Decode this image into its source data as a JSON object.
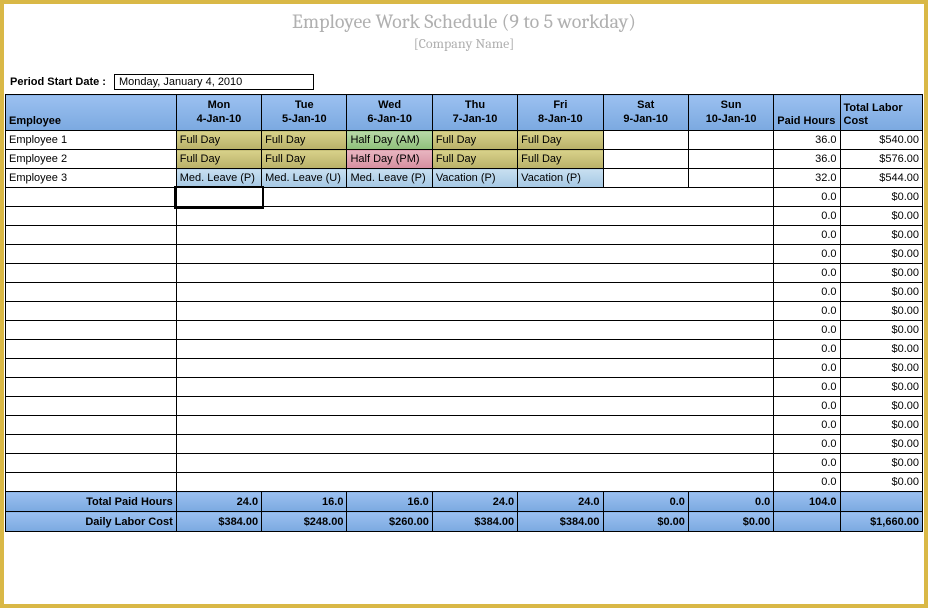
{
  "title": "Employee Work Schedule (9 to 5  workday)",
  "company": "[Company Name]",
  "period_label": "Period Start Date :",
  "period_value": "Monday, January 4, 2010",
  "cols": {
    "employee": "Employee",
    "days": [
      {
        "top": "Mon",
        "bot": "4-Jan-10"
      },
      {
        "top": "Tue",
        "bot": "5-Jan-10"
      },
      {
        "top": "Wed",
        "bot": "6-Jan-10"
      },
      {
        "top": "Thu",
        "bot": "7-Jan-10"
      },
      {
        "top": "Fri",
        "bot": "8-Jan-10"
      },
      {
        "top": "Sat",
        "bot": "9-Jan-10"
      },
      {
        "top": "Sun",
        "bot": "10-Jan-10"
      }
    ],
    "paid_hours": "Paid Hours",
    "labor_cost": "Total Labor Cost"
  },
  "rows": [
    {
      "name": "Employee 1",
      "cells": [
        {
          "t": "Full Day",
          "c": "full"
        },
        {
          "t": "Full Day",
          "c": "full"
        },
        {
          "t": "Half Day (AM)",
          "c": "half-am"
        },
        {
          "t": "Full Day",
          "c": "full"
        },
        {
          "t": "Full Day",
          "c": "full"
        },
        {
          "t": "",
          "c": ""
        },
        {
          "t": "",
          "c": ""
        }
      ],
      "ph": "36.0",
      "lc": "$540.00"
    },
    {
      "name": "Employee 2",
      "cells": [
        {
          "t": "Full Day",
          "c": "full"
        },
        {
          "t": "Full Day",
          "c": "full"
        },
        {
          "t": "Half Day (PM)",
          "c": "half-pm"
        },
        {
          "t": "Full Day",
          "c": "full"
        },
        {
          "t": "Full Day",
          "c": "full"
        },
        {
          "t": "",
          "c": ""
        },
        {
          "t": "",
          "c": ""
        }
      ],
      "ph": "36.0",
      "lc": "$576.00"
    },
    {
      "name": "Employee 3",
      "cells": [
        {
          "t": "Med. Leave (P)",
          "c": "med"
        },
        {
          "t": "Med. Leave (U)",
          "c": "med"
        },
        {
          "t": "Med. Leave (P)",
          "c": "med"
        },
        {
          "t": "Vacation (P)",
          "c": "vac"
        },
        {
          "t": "Vacation (P)",
          "c": "vac"
        },
        {
          "t": "",
          "c": ""
        },
        {
          "t": "",
          "c": ""
        }
      ],
      "ph": "32.0",
      "lc": "$544.00"
    },
    {
      "name": "",
      "cells": [
        {
          "t": "",
          "c": "",
          "sel": true
        },
        {
          "t": "",
          "c": ""
        },
        {
          "t": "",
          "c": ""
        },
        {
          "t": "",
          "c": ""
        },
        {
          "t": "",
          "c": ""
        },
        {
          "t": "",
          "c": ""
        },
        {
          "t": "",
          "c": ""
        }
      ],
      "ph": "0.0",
      "lc": "$0.00"
    },
    {
      "name": "",
      "cells": [
        {
          "t": "",
          "c": ""
        },
        {
          "t": "",
          "c": ""
        },
        {
          "t": "",
          "c": ""
        },
        {
          "t": "",
          "c": ""
        },
        {
          "t": "",
          "c": ""
        },
        {
          "t": "",
          "c": ""
        },
        {
          "t": "",
          "c": ""
        }
      ],
      "ph": "0.0",
      "lc": "$0.00"
    },
    {
      "name": "",
      "cells": [
        {
          "t": "",
          "c": ""
        },
        {
          "t": "",
          "c": ""
        },
        {
          "t": "",
          "c": ""
        },
        {
          "t": "",
          "c": ""
        },
        {
          "t": "",
          "c": ""
        },
        {
          "t": "",
          "c": ""
        },
        {
          "t": "",
          "c": ""
        }
      ],
      "ph": "0.0",
      "lc": "$0.00"
    },
    {
      "name": "",
      "cells": [
        {
          "t": "",
          "c": ""
        },
        {
          "t": "",
          "c": ""
        },
        {
          "t": "",
          "c": ""
        },
        {
          "t": "",
          "c": ""
        },
        {
          "t": "",
          "c": ""
        },
        {
          "t": "",
          "c": ""
        },
        {
          "t": "",
          "c": ""
        }
      ],
      "ph": "0.0",
      "lc": "$0.00"
    },
    {
      "name": "",
      "cells": [
        {
          "t": "",
          "c": ""
        },
        {
          "t": "",
          "c": ""
        },
        {
          "t": "",
          "c": ""
        },
        {
          "t": "",
          "c": ""
        },
        {
          "t": "",
          "c": ""
        },
        {
          "t": "",
          "c": ""
        },
        {
          "t": "",
          "c": ""
        }
      ],
      "ph": "0.0",
      "lc": "$0.00"
    },
    {
      "name": "",
      "cells": [
        {
          "t": "",
          "c": ""
        },
        {
          "t": "",
          "c": ""
        },
        {
          "t": "",
          "c": ""
        },
        {
          "t": "",
          "c": ""
        },
        {
          "t": "",
          "c": ""
        },
        {
          "t": "",
          "c": ""
        },
        {
          "t": "",
          "c": ""
        }
      ],
      "ph": "0.0",
      "lc": "$0.00"
    },
    {
      "name": "",
      "cells": [
        {
          "t": "",
          "c": ""
        },
        {
          "t": "",
          "c": ""
        },
        {
          "t": "",
          "c": ""
        },
        {
          "t": "",
          "c": ""
        },
        {
          "t": "",
          "c": ""
        },
        {
          "t": "",
          "c": ""
        },
        {
          "t": "",
          "c": ""
        }
      ],
      "ph": "0.0",
      "lc": "$0.00"
    },
    {
      "name": "",
      "cells": [
        {
          "t": "",
          "c": ""
        },
        {
          "t": "",
          "c": ""
        },
        {
          "t": "",
          "c": ""
        },
        {
          "t": "",
          "c": ""
        },
        {
          "t": "",
          "c": ""
        },
        {
          "t": "",
          "c": ""
        },
        {
          "t": "",
          "c": ""
        }
      ],
      "ph": "0.0",
      "lc": "$0.00"
    },
    {
      "name": "",
      "cells": [
        {
          "t": "",
          "c": ""
        },
        {
          "t": "",
          "c": ""
        },
        {
          "t": "",
          "c": ""
        },
        {
          "t": "",
          "c": ""
        },
        {
          "t": "",
          "c": ""
        },
        {
          "t": "",
          "c": ""
        },
        {
          "t": "",
          "c": ""
        }
      ],
      "ph": "0.0",
      "lc": "$0.00"
    },
    {
      "name": "",
      "cells": [
        {
          "t": "",
          "c": ""
        },
        {
          "t": "",
          "c": ""
        },
        {
          "t": "",
          "c": ""
        },
        {
          "t": "",
          "c": ""
        },
        {
          "t": "",
          "c": ""
        },
        {
          "t": "",
          "c": ""
        },
        {
          "t": "",
          "c": ""
        }
      ],
      "ph": "0.0",
      "lc": "$0.00"
    },
    {
      "name": "",
      "cells": [
        {
          "t": "",
          "c": ""
        },
        {
          "t": "",
          "c": ""
        },
        {
          "t": "",
          "c": ""
        },
        {
          "t": "",
          "c": ""
        },
        {
          "t": "",
          "c": ""
        },
        {
          "t": "",
          "c": ""
        },
        {
          "t": "",
          "c": ""
        }
      ],
      "ph": "0.0",
      "lc": "$0.00"
    },
    {
      "name": "",
      "cells": [
        {
          "t": "",
          "c": ""
        },
        {
          "t": "",
          "c": ""
        },
        {
          "t": "",
          "c": ""
        },
        {
          "t": "",
          "c": ""
        },
        {
          "t": "",
          "c": ""
        },
        {
          "t": "",
          "c": ""
        },
        {
          "t": "",
          "c": ""
        }
      ],
      "ph": "0.0",
      "lc": "$0.00"
    },
    {
      "name": "",
      "cells": [
        {
          "t": "",
          "c": ""
        },
        {
          "t": "",
          "c": ""
        },
        {
          "t": "",
          "c": ""
        },
        {
          "t": "",
          "c": ""
        },
        {
          "t": "",
          "c": ""
        },
        {
          "t": "",
          "c": ""
        },
        {
          "t": "",
          "c": ""
        }
      ],
      "ph": "0.0",
      "lc": "$0.00"
    },
    {
      "name": "",
      "cells": [
        {
          "t": "",
          "c": ""
        },
        {
          "t": "",
          "c": ""
        },
        {
          "t": "",
          "c": ""
        },
        {
          "t": "",
          "c": ""
        },
        {
          "t": "",
          "c": ""
        },
        {
          "t": "",
          "c": ""
        },
        {
          "t": "",
          "c": ""
        }
      ],
      "ph": "0.0",
      "lc": "$0.00"
    },
    {
      "name": "",
      "cells": [
        {
          "t": "",
          "c": ""
        },
        {
          "t": "",
          "c": ""
        },
        {
          "t": "",
          "c": ""
        },
        {
          "t": "",
          "c": ""
        },
        {
          "t": "",
          "c": ""
        },
        {
          "t": "",
          "c": ""
        },
        {
          "t": "",
          "c": ""
        }
      ],
      "ph": "0.0",
      "lc": "$0.00"
    },
    {
      "name": "",
      "cells": [
        {
          "t": "",
          "c": ""
        },
        {
          "t": "",
          "c": ""
        },
        {
          "t": "",
          "c": ""
        },
        {
          "t": "",
          "c": ""
        },
        {
          "t": "",
          "c": ""
        },
        {
          "t": "",
          "c": ""
        },
        {
          "t": "",
          "c": ""
        }
      ],
      "ph": "0.0",
      "lc": "$0.00"
    }
  ],
  "footer": {
    "r1": {
      "label": "Total Paid Hours",
      "vals": [
        "24.0",
        "16.0",
        "16.0",
        "24.0",
        "24.0",
        "0.0",
        "0.0"
      ],
      "ph": "104.0",
      "lc": ""
    },
    "r2": {
      "label": "Daily Labor Cost",
      "vals": [
        "$384.00",
        "$248.00",
        "$260.00",
        "$384.00",
        "$384.00",
        "$0.00",
        "$0.00"
      ],
      "ph": "",
      "lc": "$1,660.00"
    }
  }
}
